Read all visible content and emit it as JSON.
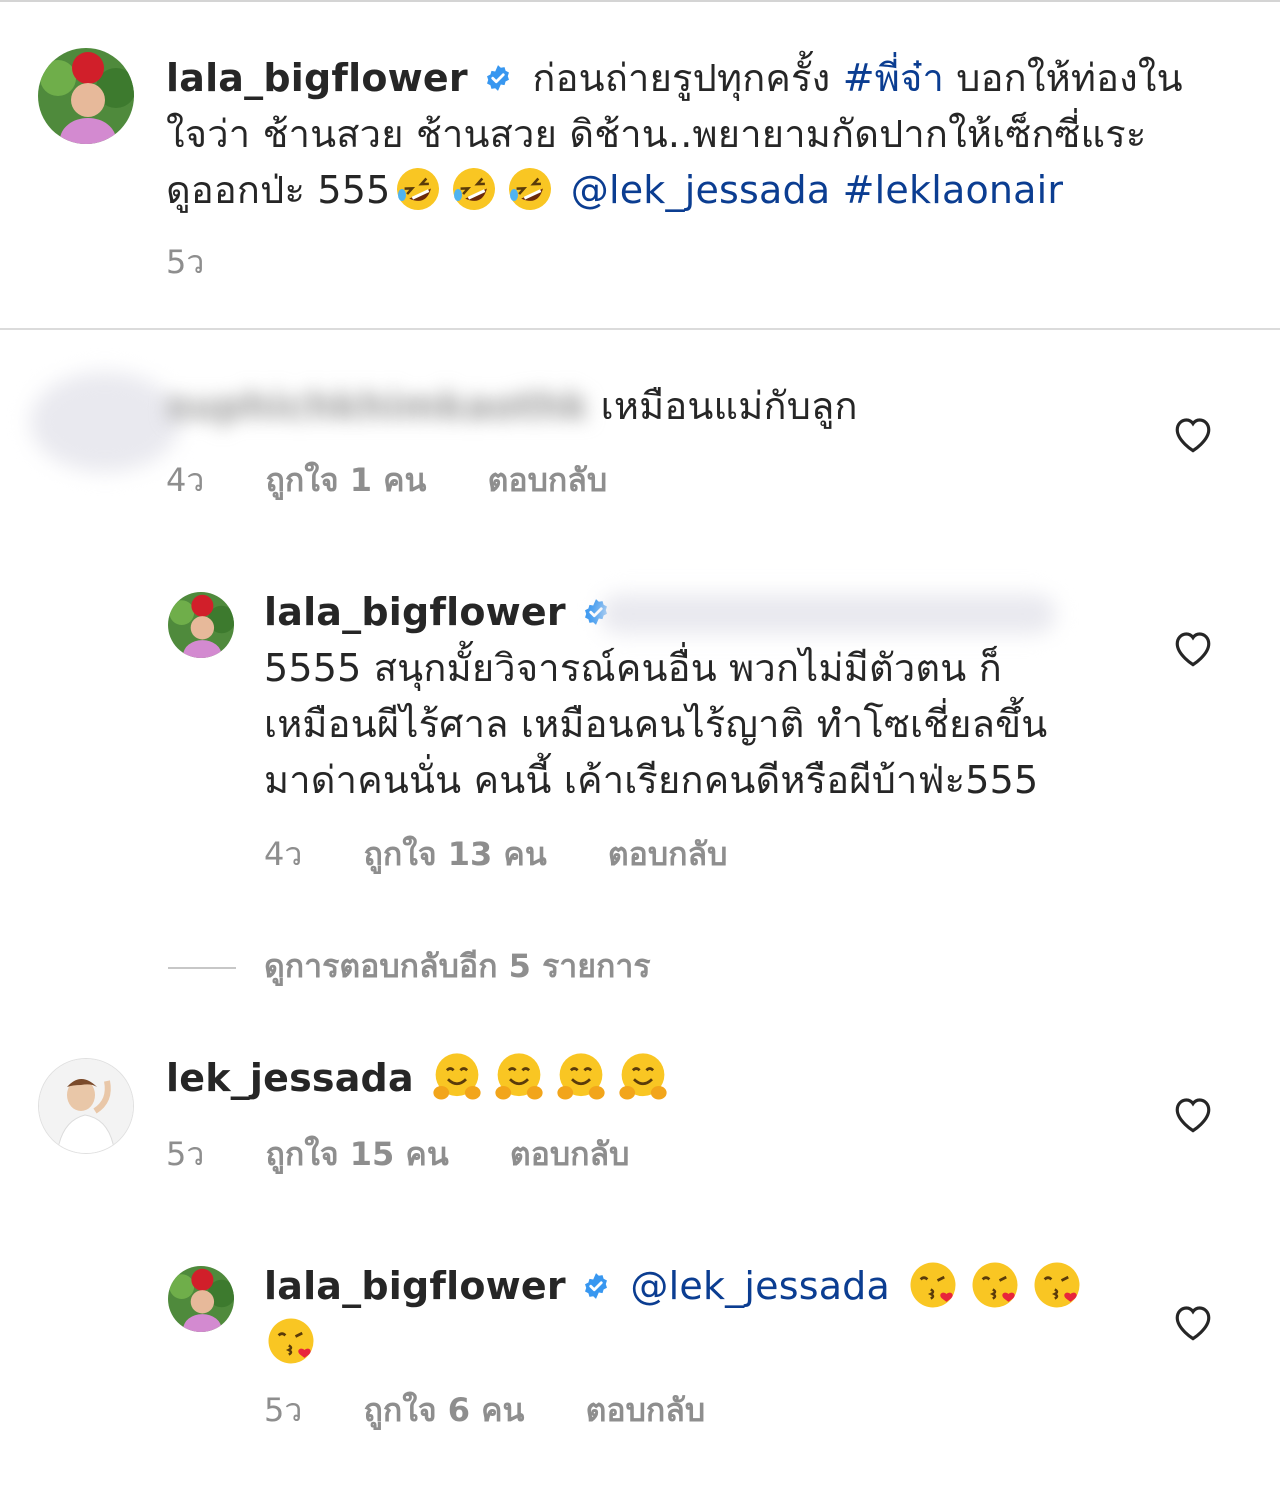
{
  "caption": {
    "username": "lala_bigflower",
    "text_before_tag": "ก่อนถ่ายรูปทุกครั้ง",
    "hashtag1": "#พี่จ๋า",
    "text_after_tag": "บอกให้ท่องใน",
    "line2": "ใจว่า ช้านสวย ช้านสวย ดิช้าน..พยายามกัดปากให้เซ็กซี่แระ",
    "line3_prefix": "ดูออกป่ะ 555",
    "mention": "@lek_jessada",
    "hashtag2": "#leklaonair",
    "time": "5ว"
  },
  "comments": [
    {
      "username": "suphichkhimkaothk",
      "text": "เหมือนแม่กับลูก",
      "time": "4ว",
      "likes": "ถูกใจ 1 คน",
      "reply": "ตอบกลับ"
    },
    {
      "username": "lala_bigflower",
      "line1": "5555 สนุกมั้ยวิจารณ์คนอื่น พวกไม่มีตัวตน ก็",
      "line2": "เหมือนผีไร้ศาล เหมือนคนไร้ญาติ ทำโซเชี่ยลขึ้น",
      "line3": "มาด่าคนนั่น คนนี้ เค้าเรียกคนดีหรือผีบ้าฟ่ะ555",
      "time": "4ว",
      "likes": "ถูกใจ 13 คน",
      "reply": "ตอบกลับ"
    },
    {
      "username": "lek_jessada",
      "time": "5ว",
      "likes": "ถูกใจ 15 คน",
      "reply": "ตอบกลับ"
    },
    {
      "username": "lala_bigflower",
      "mention": "@lek_jessada",
      "time": "5ว",
      "likes": "ถูกใจ 6 คน",
      "reply": "ตอบกลับ"
    }
  ],
  "view_replies": "ดูการตอบกลับอีก 5 รายการ",
  "icons": {
    "verified": "verified-badge-icon",
    "heart": "heart-outline-icon",
    "rofl": "rolling-on-floor-laughing-emoji",
    "hug": "hugging-face-emoji",
    "kiss": "face-blowing-kiss-emoji"
  },
  "colors": {
    "link": "#0b3d91",
    "verified": "#3897f0",
    "meta": "#8e8e8e"
  }
}
